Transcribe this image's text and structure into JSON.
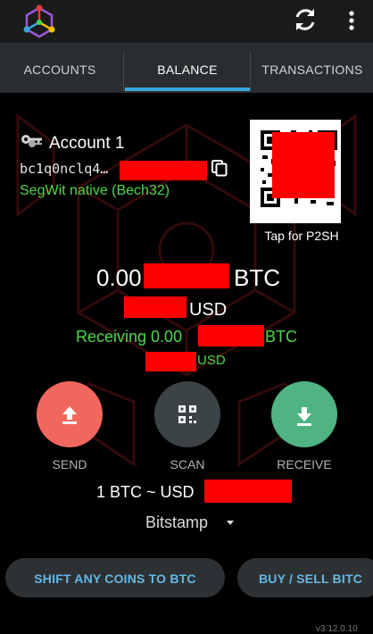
{
  "header": {
    "logo_icon": "mycelium-logo-icon",
    "refresh_icon": "refresh-icon",
    "menu_icon": "more-vert-icon"
  },
  "tabs": [
    {
      "label": "ACCOUNTS",
      "active": false
    },
    {
      "label": "BALANCE",
      "active": true
    },
    {
      "label": "TRANSACTIONS",
      "active": false
    }
  ],
  "account": {
    "icon": "key-icon",
    "name": "Account 1",
    "address_prefix": "bc1q0nclq4…",
    "address_type": "SegWit native (Bech32)",
    "copy_icon": "copy-icon"
  },
  "qr": {
    "icon": "qr-code",
    "caption": "Tap for P2SH"
  },
  "balance": {
    "btc_prefix": "0.00",
    "btc_unit": "BTC",
    "usd_unit": "USD",
    "receiving_prefix": "Receiving 0.00",
    "receiving_btc_unit": "BTC",
    "receiving_usd_unit": "USD"
  },
  "actions": [
    {
      "label": "SEND",
      "icon": "upload-icon",
      "color": "#f2675d"
    },
    {
      "label": "SCAN",
      "icon": "qr-scan-icon",
      "color": "#3c4347"
    },
    {
      "label": "RECEIVE",
      "icon": "download-icon",
      "color": "#4fb481"
    }
  ],
  "exchange_rate": {
    "label": "1 BTC ~ USD",
    "source": "Bitstamp"
  },
  "bottom_buttons": {
    "shift": "SHIFT ANY COINS TO BTC",
    "buy_sell": "BUY / SELL BITC"
  },
  "version": "v3.12.0.10",
  "colors": {
    "accent": "#3aa6dd",
    "green": "#4cd84c",
    "send": "#f2675d",
    "receive": "#4fb481",
    "redaction": "#ff0000"
  }
}
